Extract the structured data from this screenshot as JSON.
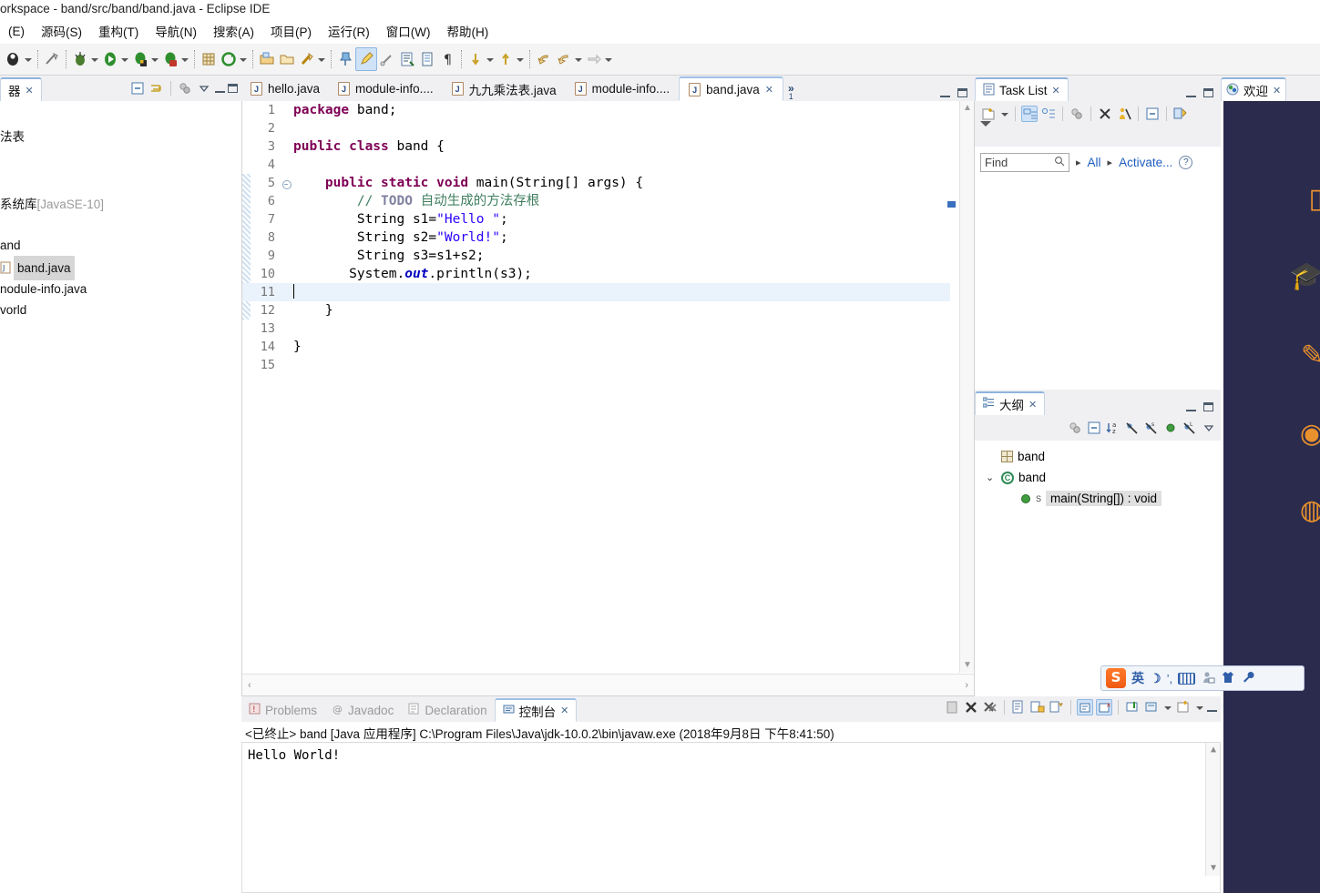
{
  "window": {
    "title": "orkspace - band/src/band/band.java - Eclipse IDE"
  },
  "menubar": {
    "items": [
      "(E)",
      "源码(S)",
      "重构(T)",
      "导航(N)",
      "搜索(A)",
      "项目(P)",
      "运行(R)",
      "窗口(W)",
      "帮助(H)"
    ]
  },
  "toolbar": {
    "icons": [
      "new-wizard-icon",
      "new-wizard-dropdown",
      "save-icon",
      "debug-icon",
      "debug-dropdown",
      "run-icon",
      "run-dropdown",
      "coverage-icon",
      "coverage-dropdown",
      "profile-icon",
      "profile-dropdown",
      "new-java-project-icon",
      "new-package-icon",
      "external-tools-icon",
      "external-tools-dropdown",
      "open-type-icon",
      "open-task-icon",
      "search-icon",
      "pin-icon",
      "highlight-icon",
      "link-icon",
      "next-annotation-icon",
      "show-whitespace-icon",
      "pilcrow-icon",
      "previous-edit-icon",
      "previous-dropdown",
      "next-edit-icon",
      "next-dropdown",
      "back-icon",
      "forward-icon",
      "forward-dropdown",
      "next-page-icon",
      "next-page-dropdown"
    ]
  },
  "package_explorer": {
    "tab_label": "理器",
    "tab_label_visible": "器",
    "toolbar_icons": [
      "collapse-all-icon",
      "link-with-editor-icon",
      "view-menu-icon"
    ],
    "items": [
      {
        "label": "法表",
        "dim": ""
      },
      {
        "label": "系统库",
        "dim": "[JavaSE-10]"
      },
      {
        "label": "and",
        "dim": ""
      },
      {
        "label": "band.java",
        "dim": "",
        "selected": true
      },
      {
        "label": "nodule-info.java",
        "dim": ""
      },
      {
        "label": "vorld",
        "dim": ""
      }
    ]
  },
  "editor": {
    "tabs": [
      {
        "label": "hello.java",
        "active": false
      },
      {
        "label": "module-info....",
        "active": false
      },
      {
        "label": "九九乘法表.java",
        "active": false
      },
      {
        "label": "module-info....",
        "active": false
      },
      {
        "label": "band.java",
        "active": true
      }
    ],
    "hidden_tabs_chevron": "»",
    "hidden_tabs_count": "1",
    "lines": [
      {
        "n": "1",
        "fold": false,
        "changed": false,
        "tokens": [
          {
            "t": "package",
            "c": "kw"
          },
          {
            "t": " band;",
            "c": ""
          }
        ]
      },
      {
        "n": "2",
        "fold": false,
        "changed": false,
        "tokens": []
      },
      {
        "n": "3",
        "fold": false,
        "changed": false,
        "tokens": [
          {
            "t": "public class",
            "c": "kw"
          },
          {
            "t": " band {",
            "c": ""
          }
        ]
      },
      {
        "n": "4",
        "fold": false,
        "changed": false,
        "tokens": []
      },
      {
        "n": "5",
        "fold": true,
        "changed": true,
        "tokens": [
          {
            "t": "    ",
            "c": ""
          },
          {
            "t": "public static void",
            "c": "kw"
          },
          {
            "t": " main(String[] args) {",
            "c": ""
          }
        ]
      },
      {
        "n": "6",
        "fold": false,
        "changed": true,
        "tokens": [
          {
            "t": "        ",
            "c": ""
          },
          {
            "t": "// ",
            "c": "cmt"
          },
          {
            "t": "TODO",
            "c": "todo"
          },
          {
            "t": " 自动生成的方法存根",
            "c": "cmt"
          }
        ]
      },
      {
        "n": "7",
        "fold": false,
        "changed": true,
        "tokens": [
          {
            "t": "        String s1=",
            "c": ""
          },
          {
            "t": "\"Hello \"",
            "c": "str"
          },
          {
            "t": ";",
            "c": ""
          }
        ]
      },
      {
        "n": "8",
        "fold": false,
        "changed": true,
        "tokens": [
          {
            "t": "        String s2=",
            "c": ""
          },
          {
            "t": "\"World!\"",
            "c": "str"
          },
          {
            "t": ";",
            "c": ""
          }
        ]
      },
      {
        "n": "9",
        "fold": false,
        "changed": true,
        "tokens": [
          {
            "t": "        String s3=s1+s2;",
            "c": ""
          }
        ]
      },
      {
        "n": "10",
        "fold": false,
        "changed": true,
        "tokens": [
          {
            "t": "       System.",
            "c": ""
          },
          {
            "t": "out",
            "c": "fld"
          },
          {
            "t": ".println(s3);",
            "c": ""
          }
        ]
      },
      {
        "n": "11",
        "fold": false,
        "changed": true,
        "current": true,
        "caret": true,
        "tokens": []
      },
      {
        "n": "12",
        "fold": false,
        "changed": true,
        "tokens": [
          {
            "t": "    }",
            "c": ""
          }
        ]
      },
      {
        "n": "13",
        "fold": false,
        "changed": false,
        "tokens": []
      },
      {
        "n": "14",
        "fold": false,
        "changed": false,
        "tokens": [
          {
            "t": "}",
            "c": ""
          }
        ]
      },
      {
        "n": "15",
        "fold": false,
        "changed": false,
        "tokens": []
      }
    ]
  },
  "task_list": {
    "tab_label": "Task List",
    "toolbar_icons": [
      "new-task-icon",
      "new-task-dropdown",
      "categorized-presentation-icon",
      "scheduled-presentation-icon",
      "focus-on-workweek-icon",
      "filter-completed-icon",
      "hide-personal-icon",
      "collapse-all-icon",
      "synchronize-changed-icon",
      "view-menu-icon"
    ],
    "find_placeholder": "Find",
    "breadcrumb": [
      "All",
      "Activate..."
    ],
    "help_icon": "help-icon"
  },
  "outline": {
    "tab_label": "大纲",
    "toolbar_icons": [
      "focus-on-active-task-icon",
      "collapse-all-icon",
      "sort-icon",
      "hide-fields-icon",
      "hide-static-icon",
      "hide-nonpublic-icon",
      "hide-local-types-icon",
      "view-menu-icon"
    ],
    "items": [
      {
        "label": "band",
        "icon": "package-icon",
        "indent": 0,
        "twisty": "",
        "selected": false
      },
      {
        "label": "band",
        "icon": "class-icon",
        "indent": 0,
        "twisty": "⌄",
        "selected": false
      },
      {
        "label": "main(String[]) : void",
        "icon": "method-icon",
        "indent": 1,
        "twisty": "",
        "selected": true,
        "modifier": "S"
      }
    ]
  },
  "welcome": {
    "tab_label": "欢迎",
    "icons": [
      "book-icon",
      "graduation-cap-icon",
      "pencil-icon",
      "compass-icon",
      "globe-icon"
    ]
  },
  "console": {
    "tabs": [
      {
        "label": "Problems",
        "icon": "problems-icon",
        "active": false
      },
      {
        "label": "Javadoc",
        "icon": "javadoc-icon",
        "active": false
      },
      {
        "label": "Declaration",
        "icon": "declaration-icon",
        "active": false
      },
      {
        "label": "控制台",
        "icon": "console-icon",
        "active": true
      }
    ],
    "toolbar_icons": [
      "clear-console-icon",
      "terminate-icon",
      "remove-all-terminated-icon",
      "show-console-icon",
      "scroll-lock-icon",
      "word-wrap-icon",
      "show-when-stdout-icon",
      "show-when-stderr-icon",
      "pin-console-icon",
      "display-selected-console-icon",
      "display-dropdown",
      "open-console-icon",
      "open-console-dropdown",
      "minimize-icon"
    ],
    "status_line": "<已终止> band [Java 应用程序] C:\\Program Files\\Java\\jdk-10.0.2\\bin\\javaw.exe  (2018年9月8日 下午8:41:50)",
    "output": "Hello World!"
  },
  "ime": {
    "name": "sogou-ime",
    "logo": "S",
    "items": [
      {
        "icon": "english-mode-icon",
        "glyph": "英"
      },
      {
        "icon": "moon-icon",
        "glyph": "☽"
      },
      {
        "icon": "punctuation-icon",
        "glyph": "’,"
      },
      {
        "icon": "soft-keyboard-icon",
        "glyph": ""
      },
      {
        "icon": "user-icon",
        "glyph": ""
      },
      {
        "icon": "skin-icon",
        "glyph": "👕"
      },
      {
        "icon": "toolbox-icon",
        "glyph": "🔧"
      }
    ]
  },
  "colors": {
    "keyword": "#7f0055",
    "string": "#2a00ff",
    "comment": "#3f7f5f",
    "field": "#0000c0",
    "accent": "#9ec1e6",
    "welcome_bg": "#2b2b4e",
    "welcome_icon": "#e8912d"
  }
}
